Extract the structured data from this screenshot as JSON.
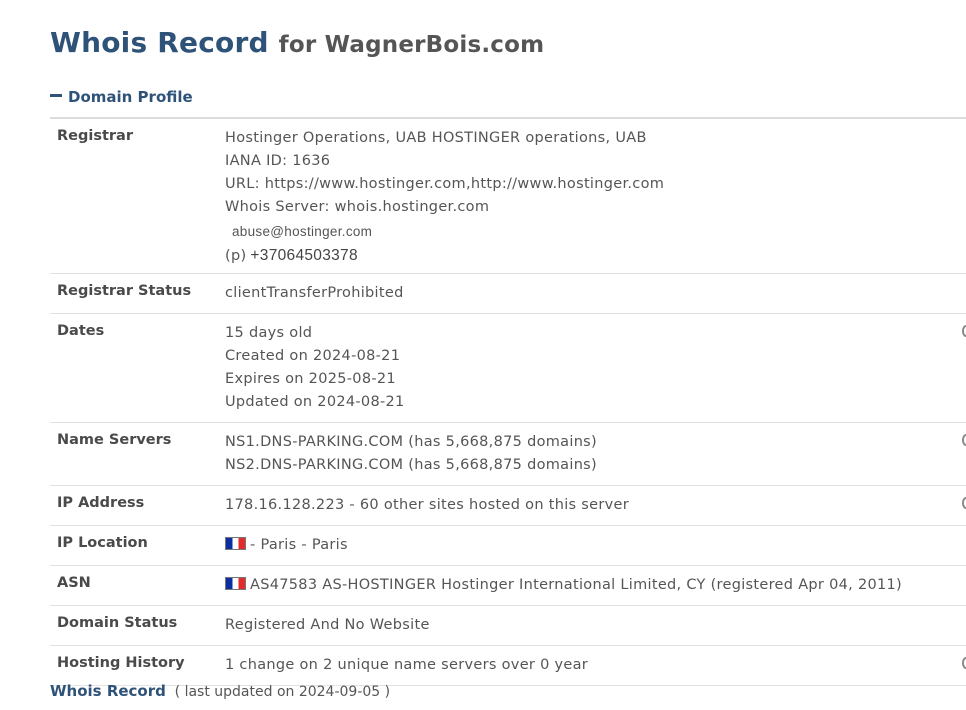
{
  "header": {
    "title": "Whois Record",
    "for_text": "for WagnerBois.com"
  },
  "section": {
    "toggle_label": "Domain Profile"
  },
  "registrar": {
    "label": "Registrar",
    "name": "Hostinger Operations, UAB HOSTINGER operations, UAB",
    "iana": "IANA ID: 1636",
    "url": "URL: https://www.hostinger.com,http://www.hostinger.com",
    "whois_server": "Whois Server: whois.hostinger.com",
    "email": "abuse@hostinger.com",
    "phone_prefix": "(p)",
    "phone": "+37064503378"
  },
  "registrar_status": {
    "label": "Registrar Status",
    "value": "clientTransferProhibited"
  },
  "dates": {
    "label": "Dates",
    "age": "15 days old",
    "created": "Created on 2024-08-21",
    "expires": "Expires on 2025-08-21",
    "updated": "Updated on 2024-08-21"
  },
  "name_servers": {
    "label": "Name Servers",
    "ns1": "NS1.DNS-PARKING.COM (has 5,668,875 domains)",
    "ns2": "NS2.DNS-PARKING.COM (has 5,668,875 domains)"
  },
  "ip_address": {
    "label": "IP Address",
    "value": "178.16.128.223 - 60 other sites hosted on this server"
  },
  "ip_location": {
    "label": "IP Location",
    "value": "- Paris - Paris",
    "flag_colors": [
      "#0b2fa1",
      "#ffffff",
      "#e22c2c"
    ]
  },
  "asn": {
    "label": "ASN",
    "value": "AS47583 AS-HOSTINGER Hostinger International Limited, CY (registered Apr 04, 2011)"
  },
  "domain_status": {
    "label": "Domain Status",
    "value": "Registered And No Website"
  },
  "hosting_history": {
    "label": "Hosting History",
    "value": "1 change on 2 unique name servers over 0 year"
  },
  "footer": {
    "link": "Whois Record",
    "updated": "( last updated on 2024-09-05 )"
  },
  "colors": {
    "heading": "#2f5378",
    "text": "#555555",
    "divider": "#e2e2e2"
  }
}
